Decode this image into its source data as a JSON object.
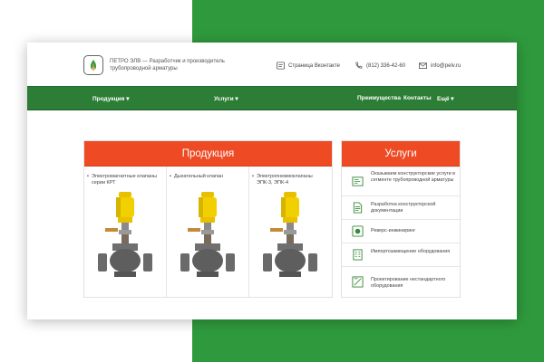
{
  "header": {
    "tagline": "ПЕТРО ЭЛВ — Разработчик и производитель трубопроводной арматуры",
    "vk_label": "Страница Вконтакте",
    "phone": "(812) 336-42-60",
    "email": "info@pelv.ru"
  },
  "nav": {
    "products": "Продукция ▾",
    "services": "Услуги ▾",
    "advantages": "Преимущества",
    "contacts": "Контакты",
    "more": "Ещё ▾"
  },
  "products": {
    "title": "Продукция",
    "items": [
      {
        "label": "Электромагнитные клапаны серии КРТ"
      },
      {
        "label": "Дыхательный клапан"
      },
      {
        "label": "Электропневмоклапаны ЭПК-3, ЭПК-4"
      }
    ]
  },
  "services": {
    "title": "Услуги",
    "items": [
      {
        "label": "Оказываем конструкторские услуги в сегменте трубопроводной арматуры",
        "icon": "blueprint-icon"
      },
      {
        "label": "Разработка конструкторской документации",
        "icon": "document-icon"
      },
      {
        "label": "Реверс-инжиниринг",
        "icon": "recycle-icon"
      },
      {
        "label": "Импортозамещение оборудования",
        "icon": "equipment-icon"
      },
      {
        "label": "Проектирование нестандартного оборудования",
        "icon": "drafting-icon"
      }
    ]
  },
  "colors": {
    "accent_orange": "#ee4a24",
    "nav_green": "#2c7d35",
    "background_green": "#2f9a3d"
  }
}
